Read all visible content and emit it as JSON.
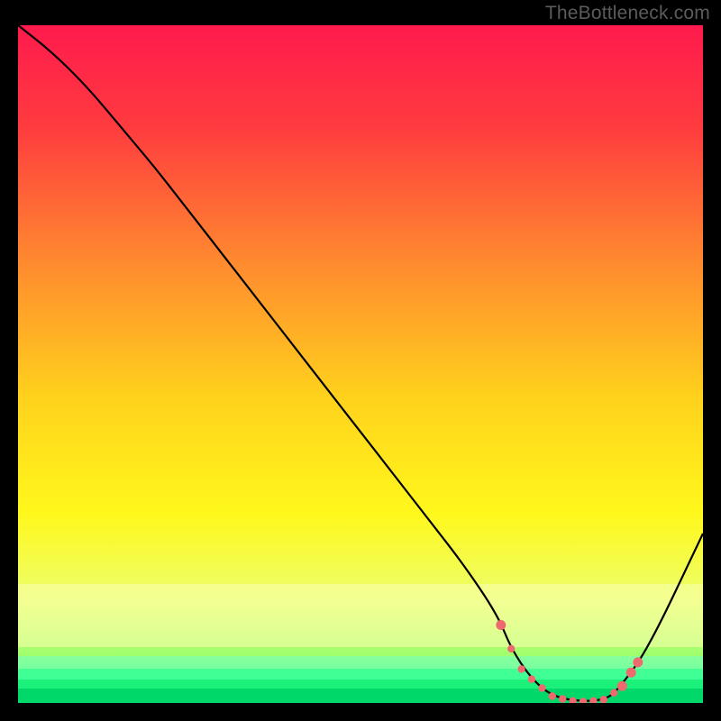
{
  "watermark": "TheBottleneck.com",
  "chart_data": {
    "type": "line",
    "title": "",
    "xlabel": "",
    "ylabel": "",
    "xlim": [
      0,
      100
    ],
    "ylim": [
      0,
      100
    ],
    "grid": false,
    "legend": false,
    "series": [
      {
        "name": "bottleneck-curve",
        "x": [
          0,
          5,
          10,
          15,
          20,
          25,
          30,
          35,
          40,
          45,
          50,
          55,
          60,
          65,
          70,
          72,
          75,
          78,
          82,
          86,
          88,
          92,
          100
        ],
        "y": [
          100,
          96,
          91,
          85,
          79,
          72.5,
          66,
          59.5,
          53,
          46.5,
          40,
          33.5,
          27,
          20.5,
          13,
          8,
          3.5,
          1.0,
          0.2,
          0.5,
          2.5,
          8,
          25
        ],
        "markers_idx": [
          11,
          12,
          13,
          14,
          15,
          16,
          17,
          18,
          19,
          20,
          21
        ]
      }
    ],
    "marker_points": {
      "x": [
        70.5,
        72.0,
        73.5,
        75.0,
        76.5,
        78.0,
        79.5,
        81.0,
        82.5,
        84.0,
        85.5,
        87.0,
        88.2,
        89.5,
        90.5
      ],
      "y": [
        11.5,
        8.0,
        5.0,
        3.5,
        2.2,
        1.0,
        0.6,
        0.3,
        0.2,
        0.3,
        0.5,
        1.5,
        2.5,
        4.5,
        6.0
      ]
    },
    "gradient_stops": [
      {
        "offset": 0.0,
        "color": "#ff1a4d"
      },
      {
        "offset": 0.15,
        "color": "#ff3b3f"
      },
      {
        "offset": 0.35,
        "color": "#ff8a2f"
      },
      {
        "offset": 0.55,
        "color": "#ffd21c"
      },
      {
        "offset": 0.72,
        "color": "#fff81c"
      },
      {
        "offset": 0.85,
        "color": "#ecff6e"
      },
      {
        "offset": 0.93,
        "color": "#9fff6e"
      },
      {
        "offset": 0.965,
        "color": "#43ff7a"
      },
      {
        "offset": 1.0,
        "color": "#00e676"
      }
    ]
  }
}
